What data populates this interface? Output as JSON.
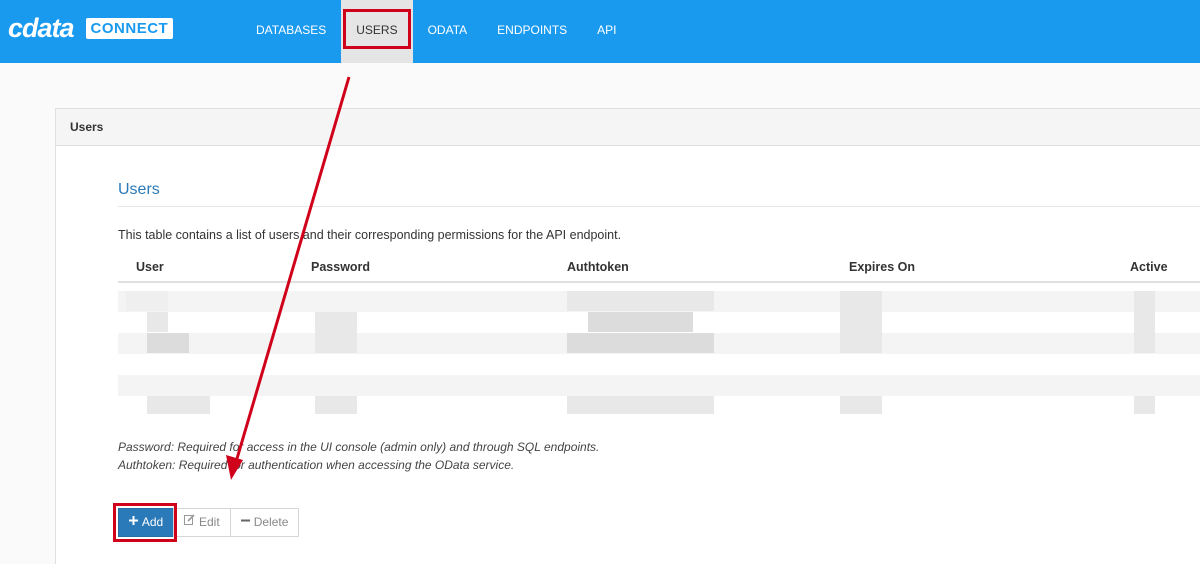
{
  "brand": {
    "name": "cdata",
    "product": "CONNECT"
  },
  "nav": {
    "items": [
      {
        "label": "DATABASES",
        "active": false
      },
      {
        "label": "USERS",
        "active": true
      },
      {
        "label": "ODATA",
        "active": false
      },
      {
        "label": "ENDPOINTS",
        "active": false
      },
      {
        "label": "API",
        "active": false
      }
    ]
  },
  "panel": {
    "heading": "Users"
  },
  "section": {
    "title": "Users",
    "description": "This table contains a list of users and their corresponding permissions for the API endpoint."
  },
  "table": {
    "columns": [
      "User",
      "Password",
      "Authtoken",
      "Expires On",
      "Active"
    ],
    "rows_redacted": true
  },
  "notes": {
    "password": "Password: Required for access in the UI console (admin only) and through SQL endpoints.",
    "authtoken": "Authtoken: Required for authentication when accessing the OData service."
  },
  "actions": {
    "add": {
      "label": "Add",
      "icon": "plus-icon"
    },
    "edit": {
      "label": "Edit",
      "icon": "edit-icon"
    },
    "delete": {
      "label": "Delete",
      "icon": "minus-icon"
    }
  },
  "colors": {
    "topbar": "#1a9aef",
    "highlight": "#d0021b",
    "primary_button": "#2a79b8",
    "section_title": "#2a7ab8"
  }
}
